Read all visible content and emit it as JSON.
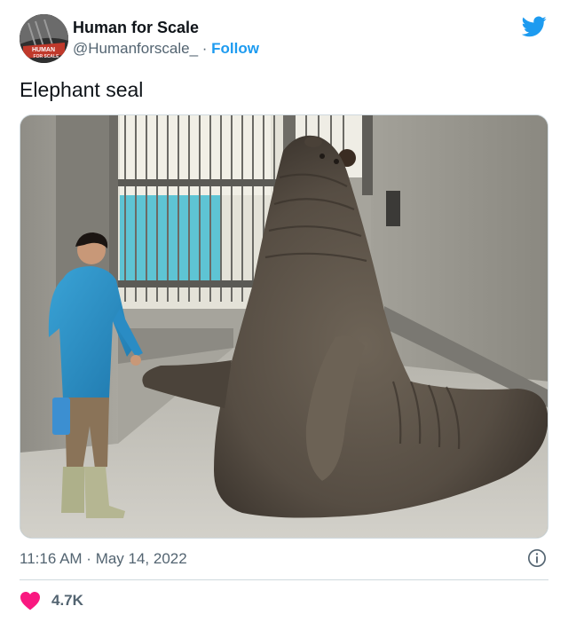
{
  "author": {
    "display_name": "Human for Scale",
    "handle": "@Humanforscale_",
    "separator": " · ",
    "follow_label": "Follow",
    "avatar_text_top": "HUMAN",
    "avatar_text_bottom": "FOR SCALE"
  },
  "tweet": {
    "text": "Elephant seal",
    "time": "11:16 AM",
    "date_separator": " · ",
    "date": "May 14, 2022"
  },
  "engagement": {
    "likes": "4.7K"
  },
  "icons": {
    "brand": "twitter-bird-icon",
    "info": "info-icon",
    "like": "heart-icon"
  },
  "colors": {
    "brand": "#1d9bf0",
    "like": "#f91880",
    "secondary_text": "#536471",
    "primary_text": "#0f1419"
  }
}
